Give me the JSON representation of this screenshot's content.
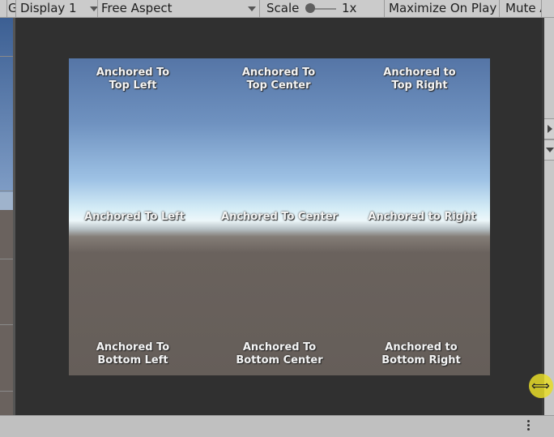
{
  "toolbar": {
    "game_label_partial": "G",
    "display": "Display 1",
    "aspect": "Free Aspect",
    "scale_label": "Scale",
    "scale_value": "1x",
    "maximize": "Maximize On Play",
    "mute": "Mute A"
  },
  "canvas": {
    "labels": {
      "top_left": [
        "Anchored To",
        "Top Left"
      ],
      "top_center": [
        "Anchored To",
        "Top Center"
      ],
      "top_right": [
        "Anchored to",
        "Top Right"
      ],
      "mid_left": "Anchored To Left",
      "mid_center": "Anchored To Center",
      "mid_right": "Anchored to Right",
      "bottom_left": [
        "Anchored To",
        "Bottom Left"
      ],
      "bottom_center": [
        "Anchored To",
        "Bottom Center"
      ],
      "bottom_right": [
        "Anchored to",
        "Bottom Right"
      ]
    }
  },
  "colors": {
    "sky_top": "#5575a6",
    "horizon": "#edf7fa",
    "ground": "#655e59",
    "cursor_highlight": "#e6dc28"
  },
  "icons": {
    "resize_cursor": "horizontal-resize-icon",
    "status_menu": "kebab-menu-icon"
  }
}
